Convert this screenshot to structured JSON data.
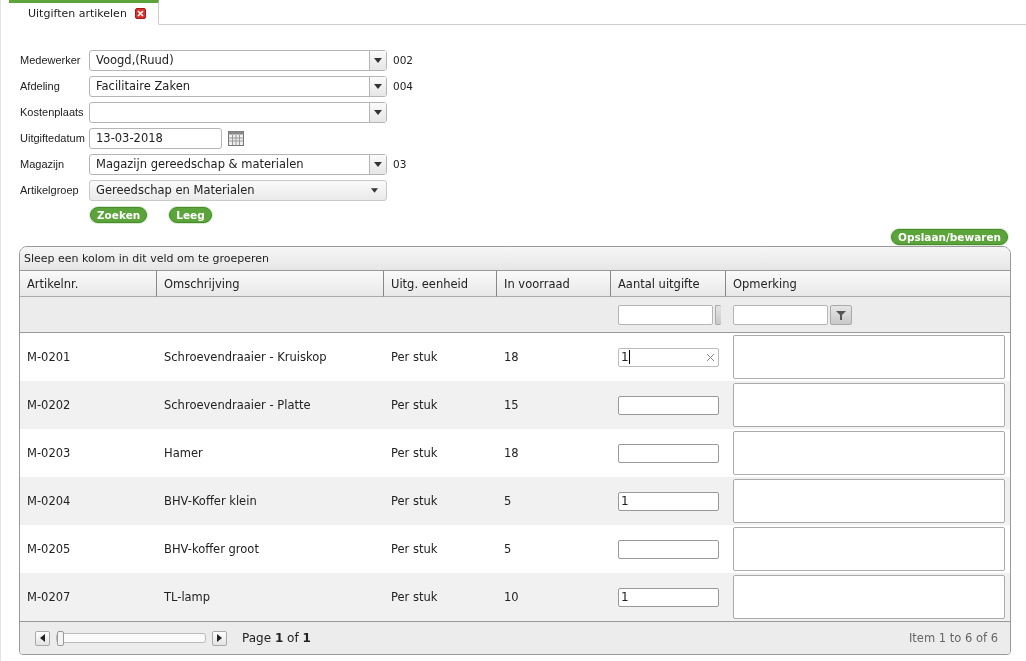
{
  "tabs": [
    {
      "label": "Uitgiften artikelen",
      "selected": true
    }
  ],
  "form": {
    "fields": [
      {
        "label": "Medewerker",
        "kind": "combo",
        "value": "Voogd,(Ruud)",
        "code": "002"
      },
      {
        "label": "Afdeling",
        "kind": "combo",
        "value": "Facilitaire Zaken",
        "code": "004"
      },
      {
        "label": "Kostenplaats",
        "kind": "combo"
      },
      {
        "label": "Uitgiftedatum",
        "kind": "date",
        "value": "13-03-2018"
      },
      {
        "label": "Magazijn",
        "kind": "combo",
        "value": "Magazijn gereedschap & materialen",
        "code": "03"
      },
      {
        "label": "Artikelgroep",
        "kind": "select",
        "value": "Gereedschap en Materialen"
      }
    ],
    "buttons": [
      "Zoeken",
      "Leeg"
    ]
  },
  "save_button": "Opslaan/bewaren",
  "grid": {
    "group_hint": "Sleep een kolom in dit veld om te groeperen",
    "columns": [
      "Artikelnr.",
      "Omschrijving",
      "Uitg. eenheid",
      "In voorraad",
      "Aantal uitgifte",
      "Opmerking"
    ],
    "rows": [
      {
        "artikelnr": "M-0201",
        "omschrijving": "Schroevendraaier - Kruiskop",
        "eenheid": "Per stuk",
        "voorraad": "18",
        "aantal": "1",
        "focused": true
      },
      {
        "artikelnr": "M-0202",
        "omschrijving": "Schroevendraaier - Platte",
        "eenheid": "Per stuk",
        "voorraad": "15",
        "aantal": "",
        "focused": false
      },
      {
        "artikelnr": "M-0203",
        "omschrijving": "Hamer",
        "eenheid": "Per stuk",
        "voorraad": "18",
        "aantal": "",
        "focused": false
      },
      {
        "artikelnr": "M-0204",
        "omschrijving": "BHV-Koffer klein",
        "eenheid": "Per stuk",
        "voorraad": "5",
        "aantal": "1",
        "focused": false
      },
      {
        "artikelnr": "M-0205",
        "omschrijving": "BHV-koffer groot",
        "eenheid": "Per stuk",
        "voorraad": "5",
        "aantal": "",
        "focused": false
      },
      {
        "artikelnr": "M-0207",
        "omschrijving": "TL-lamp",
        "eenheid": "Per stuk",
        "voorraad": "10",
        "aantal": "1",
        "focused": false
      }
    ],
    "pager": {
      "slider": {
        "level": 0
      },
      "page_text": "Page **1** of **1**",
      "info": "Item 1 to 6 of 6"
    }
  }
}
